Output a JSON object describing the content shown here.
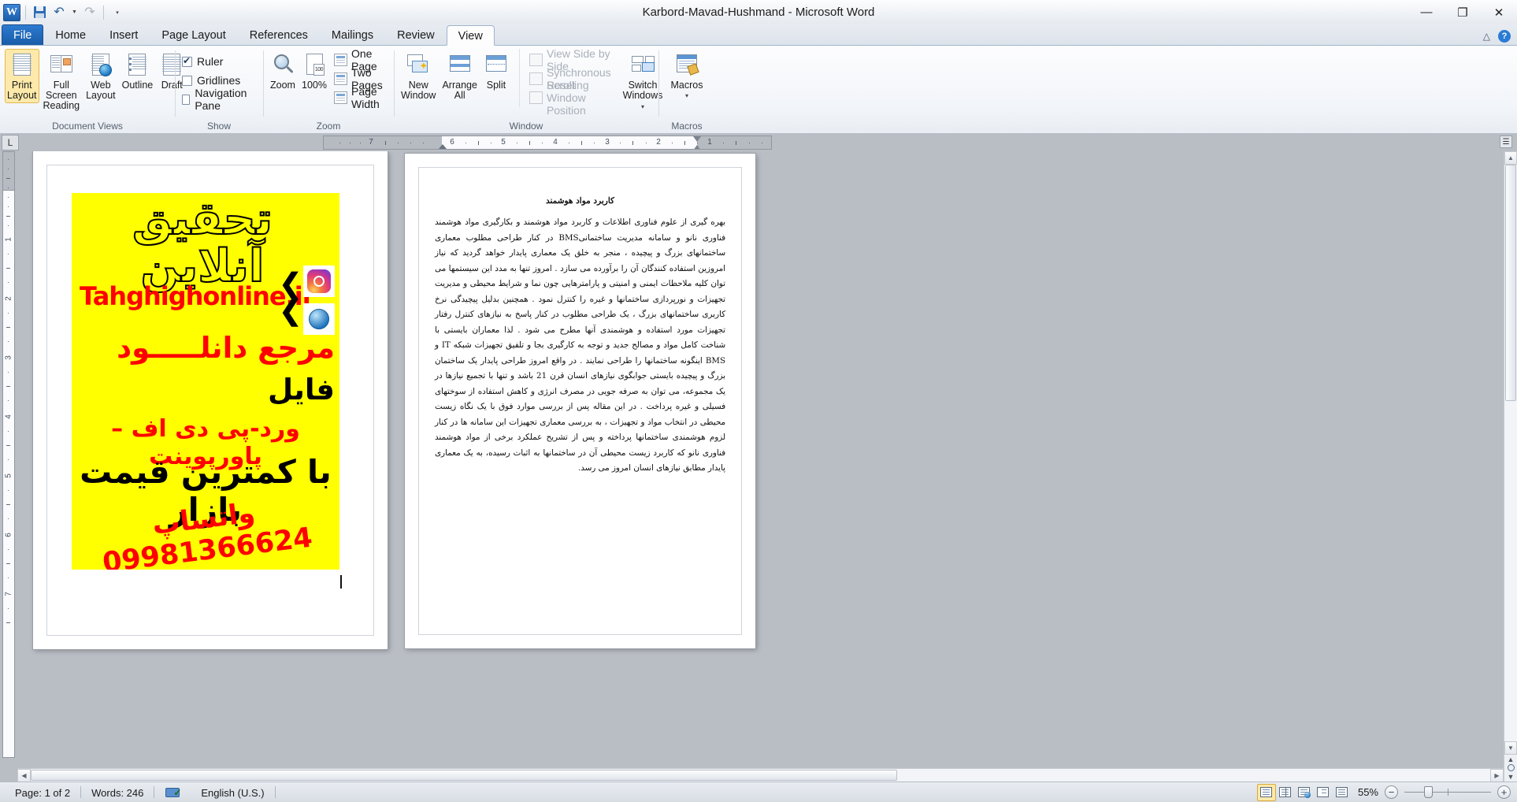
{
  "window": {
    "title": "Karbord-Mavad-Hushmand  -  Microsoft Word",
    "minimize": "—",
    "restore": "❐",
    "close": "✕"
  },
  "quick_access": {
    "app_icon": "word-logo",
    "items": [
      {
        "name": "save-icon",
        "label": "Save"
      },
      {
        "name": "undo-icon",
        "label": "Undo"
      },
      {
        "name": "redo-icon",
        "label": "Redo"
      },
      {
        "name": "customize-qat-icon",
        "label": "Customize Quick Access Toolbar"
      }
    ]
  },
  "tabs": [
    {
      "label": "File",
      "kind": "file"
    },
    {
      "label": "Home",
      "kind": "normal"
    },
    {
      "label": "Insert",
      "kind": "normal"
    },
    {
      "label": "Page Layout",
      "kind": "normal"
    },
    {
      "label": "References",
      "kind": "normal"
    },
    {
      "label": "Mailings",
      "kind": "normal"
    },
    {
      "label": "Review",
      "kind": "normal"
    },
    {
      "label": "View",
      "kind": "active"
    }
  ],
  "tab_right": {
    "collapse_ribbon": "△",
    "help": "?"
  },
  "ribbon": {
    "groups": [
      {
        "name": "document-views",
        "label": "Document Views",
        "buttons": [
          {
            "label": "Print Layout",
            "selected": true,
            "icon": "print-layout-icon"
          },
          {
            "label": "Full Screen Reading",
            "selected": false,
            "icon": "full-screen-reading-icon"
          },
          {
            "label": "Web Layout",
            "selected": false,
            "icon": "web-layout-icon"
          },
          {
            "label": "Outline",
            "selected": false,
            "icon": "outline-icon"
          },
          {
            "label": "Draft",
            "selected": false,
            "icon": "draft-icon"
          }
        ]
      },
      {
        "name": "show",
        "label": "Show",
        "checkboxes": [
          {
            "label": "Ruler",
            "checked": true
          },
          {
            "label": "Gridlines",
            "checked": false
          },
          {
            "label": "Navigation Pane",
            "checked": false
          }
        ]
      },
      {
        "name": "zoom",
        "label": "Zoom",
        "buttons": [
          {
            "label": "Zoom",
            "icon": "magnifier-icon"
          },
          {
            "label": "100%",
            "icon": "zoom-100-icon"
          }
        ],
        "items": [
          {
            "label": "One Page",
            "icon": "one-page-icon"
          },
          {
            "label": "Two Pages",
            "icon": "two-pages-icon"
          },
          {
            "label": "Page Width",
            "icon": "page-width-icon"
          }
        ]
      },
      {
        "name": "window",
        "label": "Window",
        "buttons": [
          {
            "label": "New Window",
            "icon": "new-window-icon"
          },
          {
            "label": "Arrange All",
            "icon": "arrange-all-icon"
          },
          {
            "label": "Split",
            "icon": "split-icon"
          }
        ],
        "items": [
          {
            "label": "View Side by Side",
            "icon": "view-side-by-side-icon",
            "disabled": true
          },
          {
            "label": "Synchronous Scrolling",
            "icon": "synchronous-scrolling-icon",
            "disabled": true
          },
          {
            "label": "Reset Window Position",
            "icon": "reset-window-position-icon",
            "disabled": true
          }
        ],
        "switch_windows": {
          "line1": "Switch",
          "line2": "Windows",
          "icon": "switch-windows-icon"
        }
      },
      {
        "name": "macros",
        "label": "Macros",
        "buttons": [
          {
            "label": "Macros",
            "icon": "macros-icon"
          }
        ]
      }
    ]
  },
  "ruler": {
    "tab_stop_selector": "L",
    "horizontal_numbers": [
      "7",
      "6",
      "5",
      "4",
      "3",
      "2",
      "1"
    ],
    "vertical_numbers": [
      "1",
      "2",
      "3",
      "4",
      "5",
      "6",
      "7"
    ]
  },
  "document": {
    "page1": {
      "ad": {
        "title": "تحقیق آنلاین",
        "url": "Tahghighonline.ir",
        "line1": "مرجع دانلـــــود",
        "line2": "فایل",
        "line3": "ورد-پی دی اف – پاورپوینت",
        "line4": "با کمترین قیمت بازار",
        "line5": "واتساپ 09981366624",
        "instagram_icon": "instagram-icon",
        "web_icon": "web-globe-icon",
        "background_color": "#ffff00",
        "red_color": "#ff0000"
      }
    },
    "page2": {
      "heading": "کاربرد مواد هوشمند",
      "paragraph": "بهره گیری از علوم فناوری اطلاعات و کاربرد مواد هوشمند و بکارگیری مواد هوشمند فناوری نانو و سامانه مدیریت ساختمانیBMS در کنار طراحی مطلوب معماری ساختمانهای بزرگ و پیچیده ، منجر به خلق یک معماری پایدار خواهد گردید که نیاز امروزین استفاده کنندگان آن را برآورده می سازد . امروز تنها به مدد این سیستمها می توان کلیه ملاحظات ایمنی و امنیتی و پارامترهایی چون نما و شرایط محیطی و مدیریت تجهیزات و نورپردازی ساختمانها و غیره را کنترل نمود . همچنین بدلیل پیچیدگی نرخ کاربری ساختمانهای بزرگ ، یک طراحی مطلوب در کنار پاسخ به نیازهای کنترل رفتار تجهیزات مورد استفاده و هوشمندی آنها مطرح می شود . لذا معماران بایستی با شناخت کامل مواد و مصالح جدید و توجه به کارگیری بجا و تلفیق تجهیزات شبکه IT و BMS اینگونه ساختمانها را طراحی نمایند . در واقع امروز طراحی پایدار یک ساختمان بزرگ و پیچیده بایستی جوابگوی نیازهای انسان قرن 21 باشد و تنها با تجمیع نیازها در یک مجموعه، می توان به صرفه جویی در مصرف انرژی و کاهش استفاده از سوختهای فسیلی و غیره پرداخت . در این مقاله پس از بررسی موارد فوق با یک نگاه زیست محیطی در انتخاب مواد و تجهیزات ، به بررسی معماری تجهیزات این سامانه ها در کنار لزوم هوشمندی ساختمانها پرداخته و پس از تشریح عملکرد برخی از مواد هوشمند فناوری نانو که کاربرد زیست محیطی آن در ساختمانها به اثبات رسیده، به یک معماری پایدار مطابق نیازهای انسان امروز می رسد."
    }
  },
  "status_bar": {
    "page": "Page: 1 of 2",
    "words": "Words: 246",
    "spell_icon": "spell-check-icon",
    "language": "English (U.S.)",
    "view_buttons": [
      {
        "name": "print-layout-view-icon",
        "label": "Print Layout",
        "selected": true
      },
      {
        "name": "full-screen-reading-view-icon",
        "label": "Full Screen Reading",
        "selected": false
      },
      {
        "name": "web-layout-view-icon",
        "label": "Web Layout",
        "selected": false
      },
      {
        "name": "outline-view-icon",
        "label": "Outline",
        "selected": false
      },
      {
        "name": "draft-view-icon",
        "label": "Draft",
        "selected": false
      }
    ],
    "zoom_percent": "55%",
    "zoom_out": "−",
    "zoom_in": "+"
  },
  "scroll": {
    "up_arrow": "▲",
    "down_arrow": "▼",
    "left_arrow": "◀",
    "right_arrow": "▶",
    "prev_page": "▲",
    "select_browse_object": "●",
    "next_page": "▼"
  }
}
